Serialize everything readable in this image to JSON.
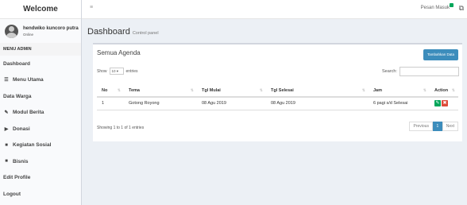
{
  "app": {
    "title": "Welcome"
  },
  "user": {
    "name": "hendwiko kuncoro putra",
    "status": "Online"
  },
  "sidebar": {
    "header": "MENU ADMIN",
    "items": [
      {
        "label": "Dashboard",
        "icon": ""
      },
      {
        "label": "Menu Utama",
        "icon": "list-icon"
      },
      {
        "label": "Data Warga",
        "icon": ""
      },
      {
        "label": "Modul Berita",
        "icon": "pencil-icon"
      },
      {
        "label": "Donasi",
        "icon": "play-icon"
      },
      {
        "label": "Kegiatan Sosial",
        "icon": "database-icon"
      },
      {
        "label": "Bisnis",
        "icon": "database-icon"
      },
      {
        "label": "Edit Profile",
        "icon": ""
      },
      {
        "label": "Logout",
        "icon": ""
      }
    ]
  },
  "topbar": {
    "message_label": "Pesan Masuk"
  },
  "page": {
    "title": "Dashboard",
    "subtitle": "Control panel"
  },
  "box": {
    "title": "Semua Agenda",
    "add_button": "Tambahkan Data",
    "length": {
      "show": "Show",
      "value": "10",
      "entries": "entries"
    },
    "search_label": "Search:",
    "columns": [
      "No",
      "Tema",
      "Tgl Mulai",
      "Tgl Selesai",
      "Jam",
      "Action"
    ],
    "rows": [
      {
        "no": "1",
        "tema": "Gotong Royong",
        "mulai": "08 Agu 2019",
        "selesai": "08 Agu 2019",
        "jam": "6 pagi s/d Selesai"
      }
    ],
    "info": "Showing 1 to 1 of 1 entries",
    "pager": {
      "previous": "Previous",
      "current": "1",
      "next": "Next"
    }
  },
  "colors": {
    "primary": "#3c8dbc",
    "success": "#00a65a",
    "danger": "#dd4b39"
  }
}
